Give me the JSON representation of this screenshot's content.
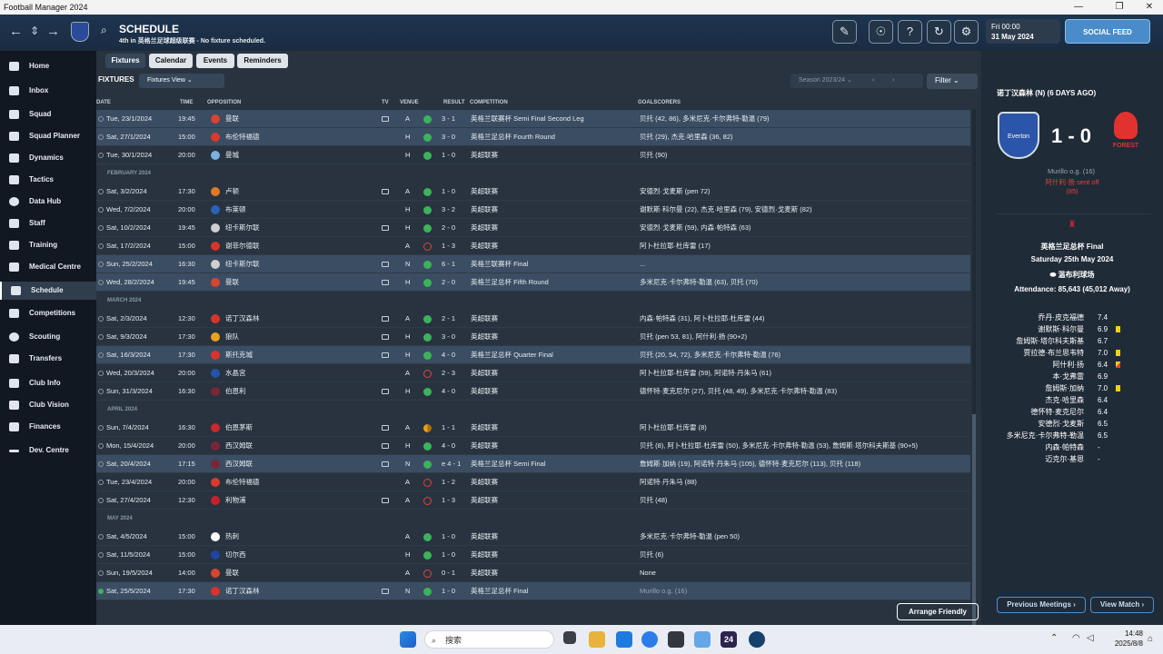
{
  "window": {
    "title": "Football Manager 2024"
  },
  "header": {
    "title": "SCHEDULE",
    "subtitle": "4th in 英格兰足球超级联赛 - No fixture scheduled.",
    "date_line1": "Fri 00:00",
    "date_line2": "31 May 2024",
    "social_feed": "SOCIAL FEED"
  },
  "sidebar": {
    "items": [
      {
        "label": "Home"
      },
      {
        "label": "Inbox"
      },
      {
        "label": "Squad"
      },
      {
        "label": "Squad Planner"
      },
      {
        "label": "Dynamics"
      },
      {
        "label": "Tactics"
      },
      {
        "label": "Data Hub"
      },
      {
        "label": "Staff"
      },
      {
        "label": "Training"
      },
      {
        "label": "Medical Centre"
      },
      {
        "label": "Schedule"
      },
      {
        "label": "Competitions"
      },
      {
        "label": "Scouting"
      },
      {
        "label": "Transfers"
      },
      {
        "label": "Club Info"
      },
      {
        "label": "Club Vision"
      },
      {
        "label": "Finances"
      },
      {
        "label": "Dev. Centre"
      }
    ]
  },
  "tabs": [
    "Fixtures",
    "Calendar",
    "Events",
    "Reminders"
  ],
  "toolbar": {
    "fixtures_label": "FIXTURES",
    "fixtures_view": "Fixtures View",
    "season": "Season 2023/24",
    "filter": "Filter"
  },
  "columns": {
    "date": "DATE",
    "time": "TIME",
    "opposition": "OPPOSITION",
    "tv": "TV",
    "venue": "VENUE",
    "result": "RESULT",
    "competition": "COMPETITION",
    "goalscorers": "GOALSCORERS"
  },
  "rows": [
    {
      "kind": "match",
      "date": "Tue, 23/1/2024",
      "time": "19:45",
      "opp": "曼联",
      "tv": true,
      "venue": "A",
      "res": "w",
      "score": "3 - 1",
      "comp": "英格兰联赛杯 Semi Final Second Leg",
      "scorers": "贝托 (42, 86), 多米尼克·卡尔弗特-勒温 (79)",
      "hl": true,
      "crest": "#d6452f"
    },
    {
      "kind": "match",
      "date": "Sat, 27/1/2024",
      "time": "15:00",
      "opp": "布伦特福德",
      "tv": false,
      "venue": "H",
      "res": "w",
      "score": "3 - 0",
      "comp": "英格兰足总杯 Fourth Round",
      "scorers": "贝托 (29), 杰克·哈里森 (36, 82)",
      "hl": true,
      "crest": "#d93a2c"
    },
    {
      "kind": "match",
      "date": "Tue, 30/1/2024",
      "time": "20:00",
      "opp": "曼城",
      "tv": false,
      "venue": "H",
      "res": "w",
      "score": "1 - 0",
      "comp": "英超联赛",
      "scorers": "贝托 (90)",
      "hl": false,
      "crest": "#7ab3e0"
    },
    {
      "kind": "section",
      "label": "FEBRUARY 2024"
    },
    {
      "kind": "match",
      "date": "Sat, 3/2/2024",
      "time": "17:30",
      "opp": "卢顿",
      "tv": true,
      "venue": "A",
      "res": "w",
      "score": "1 - 0",
      "comp": "英超联赛",
      "scorers": "安德烈·戈麦斯 (pen 72)",
      "hl": false,
      "crest": "#e07a22"
    },
    {
      "kind": "match",
      "date": "Wed, 7/2/2024",
      "time": "20:00",
      "opp": "布莱顿",
      "tv": false,
      "venue": "H",
      "res": "w",
      "score": "3 - 2",
      "comp": "英超联赛",
      "scorers": "谢默斯·科尔曼 (22), 杰克·哈里森 (79), 安德烈·戈麦斯 (82)",
      "hl": false,
      "crest": "#2a62b8"
    },
    {
      "kind": "match",
      "date": "Sat, 10/2/2024",
      "time": "19:45",
      "opp": "纽卡斯尔联",
      "tv": true,
      "venue": "H",
      "res": "w",
      "score": "2 - 0",
      "comp": "英超联赛",
      "scorers": "安德烈·戈麦斯 (59), 内森·帕特森 (63)",
      "hl": false,
      "crest": "#cfcfcf"
    },
    {
      "kind": "match",
      "date": "Sat, 17/2/2024",
      "time": "15:00",
      "opp": "谢菲尔德联",
      "tv": false,
      "venue": "A",
      "res": "l",
      "score": "1 - 3",
      "comp": "英超联赛",
      "scorers": "阿卜杜拉耶·杜库雷 (17)",
      "hl": false,
      "crest": "#d8342b"
    },
    {
      "kind": "match",
      "date": "Sun, 25/2/2024",
      "time": "16:30",
      "opp": "纽卡斯尔联",
      "tv": true,
      "venue": "N",
      "res": "w",
      "score": "6 - 1",
      "comp": "英格兰联赛杯 Final",
      "scorers": "...",
      "hl": true,
      "crest": "#cfcfcf"
    },
    {
      "kind": "match",
      "date": "Wed, 28/2/2024",
      "time": "19:45",
      "opp": "曼联",
      "tv": true,
      "venue": "H",
      "res": "w",
      "score": "2 - 0",
      "comp": "英格兰足总杯 Fifth Round",
      "scorers": "多米尼克·卡尔弗特-勒温 (63), 贝托 (70)",
      "hl": true,
      "crest": "#d6452f"
    },
    {
      "kind": "section",
      "label": "MARCH 2024"
    },
    {
      "kind": "match",
      "date": "Sat, 2/3/2024",
      "time": "12:30",
      "opp": "诺丁汉森林",
      "tv": true,
      "venue": "A",
      "res": "w",
      "score": "2 - 1",
      "comp": "英超联赛",
      "scorers": "内森·帕特森 (31), 阿卜杜拉耶·杜库雷 (44)",
      "hl": false,
      "crest": "#d8342b"
    },
    {
      "kind": "match",
      "date": "Sat, 9/3/2024",
      "time": "17:30",
      "opp": "狼队",
      "tv": true,
      "venue": "H",
      "res": "w",
      "score": "3 - 0",
      "comp": "英超联赛",
      "scorers": "贝托 (pen 53, 81), 阿什利·扬 (90+2)",
      "hl": false,
      "crest": "#e8a21c"
    },
    {
      "kind": "match",
      "date": "Sat, 16/3/2024",
      "time": "17:30",
      "opp": "斯托克城",
      "tv": true,
      "venue": "H",
      "res": "w",
      "score": "4 - 0",
      "comp": "英格兰足总杯 Quarter Final",
      "scorers": "贝托 (20, 54, 72), 多米尼克·卡尔弗特-勒温 (76)",
      "hl": true,
      "crest": "#d8342b"
    },
    {
      "kind": "match",
      "date": "Wed, 20/3/2024",
      "time": "20:00",
      "opp": "水晶宫",
      "tv": false,
      "venue": "A",
      "res": "l",
      "score": "2 - 3",
      "comp": "英超联赛",
      "scorers": "阿卜杜拉耶·杜库雷 (59), 阿诺特·丹朱马 (61)",
      "hl": false,
      "crest": "#2553a8"
    },
    {
      "kind": "match",
      "date": "Sun, 31/3/2024",
      "time": "16:30",
      "opp": "伯恩利",
      "tv": true,
      "venue": "H",
      "res": "w",
      "score": "4 - 0",
      "comp": "英超联赛",
      "scorers": "德怀特·麦克尼尔 (27), 贝托 (48, 49), 多米尼克·卡尔弗特-勒温 (83)",
      "hl": false,
      "crest": "#7a2638"
    },
    {
      "kind": "section",
      "label": "APRIL 2024"
    },
    {
      "kind": "match",
      "date": "Sun, 7/4/2024",
      "time": "16:30",
      "opp": "伯恩茅斯",
      "tv": true,
      "venue": "A",
      "res": "d",
      "score": "1 - 1",
      "comp": "英超联赛",
      "scorers": "阿卜杜拉耶·杜库雷 (8)",
      "hl": false,
      "crest": "#c8282e"
    },
    {
      "kind": "match",
      "date": "Mon, 15/4/2024",
      "time": "20:00",
      "opp": "西汉姆联",
      "tv": true,
      "venue": "H",
      "res": "w",
      "score": "4 - 0",
      "comp": "英超联赛",
      "scorers": "贝托 (8), 阿卜杜拉耶·杜库雷 (50), 多米尼克·卡尔弗特-勒温 (53), 詹姆斯·塔尔科夫斯基 (90+5)",
      "hl": false,
      "crest": "#7a2638"
    },
    {
      "kind": "match",
      "date": "Sat, 20/4/2024",
      "time": "17:15",
      "opp": "西汉姆联",
      "tv": true,
      "venue": "N",
      "res": "w",
      "score": "e 4 - 1",
      "comp": "英格兰足总杯 Semi Final",
      "scorers": "詹姆斯·加纳 (19), 阿诺特·丹朱马 (105), 德怀特·麦克尼尔 (113), 贝托 (118)",
      "hl": true,
      "crest": "#7a2638"
    },
    {
      "kind": "match",
      "date": "Tue, 23/4/2024",
      "time": "20:00",
      "opp": "布伦特福德",
      "tv": false,
      "venue": "A",
      "res": "l",
      "score": "1 - 2",
      "comp": "英超联赛",
      "scorers": "阿诺特·丹朱马 (88)",
      "hl": false,
      "crest": "#d93a2c"
    },
    {
      "kind": "match",
      "date": "Sat, 27/4/2024",
      "time": "12:30",
      "opp": "利物浦",
      "tv": true,
      "venue": "A",
      "res": "l",
      "score": "1 - 3",
      "comp": "英超联赛",
      "scorers": "贝托 (48)",
      "hl": false,
      "crest": "#c8202e"
    },
    {
      "kind": "section",
      "label": "MAY 2024"
    },
    {
      "kind": "match",
      "date": "Sat, 4/5/2024",
      "time": "15:00",
      "opp": "热刺",
      "tv": false,
      "venue": "A",
      "res": "w",
      "score": "1 - 0",
      "comp": "英超联赛",
      "scorers": "多米尼克·卡尔弗特-勒温 (pen 50)",
      "hl": false,
      "crest": "#ffffff"
    },
    {
      "kind": "match",
      "date": "Sat, 11/5/2024",
      "time": "15:00",
      "opp": "切尔西",
      "tv": false,
      "venue": "H",
      "res": "w",
      "score": "1 - 0",
      "comp": "英超联赛",
      "scorers": "贝托 (6)",
      "hl": false,
      "crest": "#2045a0"
    },
    {
      "kind": "match",
      "date": "Sun, 19/5/2024",
      "time": "14:00",
      "opp": "曼联",
      "tv": false,
      "venue": "A",
      "res": "l",
      "score": "0 - 1",
      "comp": "英超联赛",
      "scorers": "None",
      "hl": false,
      "crest": "#d6452f"
    },
    {
      "kind": "match",
      "date": "Sat, 25/5/2024",
      "time": "17:30",
      "opp": "诺丁汉森林",
      "tv": true,
      "venue": "N",
      "res": "w",
      "score": "1 - 0",
      "comp": "英格兰足总杯 Final",
      "scorers": "Murillo o.g. (16)",
      "hl": true,
      "crest": "#d8342b"
    }
  ],
  "arrange_friendly": "Arrange Friendly",
  "match_panel": {
    "title": "诺丁汉森林 (N) (6 DAYS AGO)",
    "home_badge": "Everton",
    "away_badge": "FOREST",
    "score": "1 - 0",
    "event1": "Murillo o.g. (16)",
    "event2": "阿什利·扬 sent off",
    "event2_min": "(85)",
    "competition": "英格兰足总杯 Final",
    "date": "Saturday 25th May 2024",
    "stadium": "温布利球场",
    "attendance": "Attendance: 85,643 (45,012 Away)",
    "ratings": [
      {
        "name": "乔丹·皮克福德",
        "val": "7.4",
        "card": ""
      },
      {
        "name": "谢默斯·科尔曼",
        "val": "6.9",
        "card": "y"
      },
      {
        "name": "詹姆斯·塔尔科夫斯基",
        "val": "6.7",
        "card": ""
      },
      {
        "name": "贾拉德·布兰思韦特",
        "val": "7.0",
        "card": "y"
      },
      {
        "name": "阿什利·扬",
        "val": "6.4",
        "card": "r"
      },
      {
        "name": "本·戈弗雷",
        "val": "6.9",
        "card": ""
      },
      {
        "name": "詹姆斯·加纳",
        "val": "7.0",
        "card": "y"
      },
      {
        "name": "杰克·哈里森",
        "val": "6.4",
        "card": ""
      },
      {
        "name": "德怀特·麦克尼尔",
        "val": "6.4",
        "card": ""
      },
      {
        "name": "安德烈·戈麦斯",
        "val": "6.5",
        "card": ""
      },
      {
        "name": "多米尼克·卡尔弗特-勒温",
        "val": "6.5",
        "card": ""
      },
      {
        "name": "内森·帕特森",
        "val": "-",
        "card": ""
      },
      {
        "name": "迈克尔·基恩",
        "val": "-",
        "card": ""
      }
    ],
    "prev_btn": "Previous Meetings ›",
    "view_btn": "View Match ›"
  },
  "taskbar": {
    "search": "搜索",
    "time": "14:48",
    "date": "2025/8/8"
  },
  "colors": {
    "win": "#3cb35a",
    "loss": "#e0453a",
    "draw": "#e8a11c",
    "accent": "#4a8cc9"
  }
}
